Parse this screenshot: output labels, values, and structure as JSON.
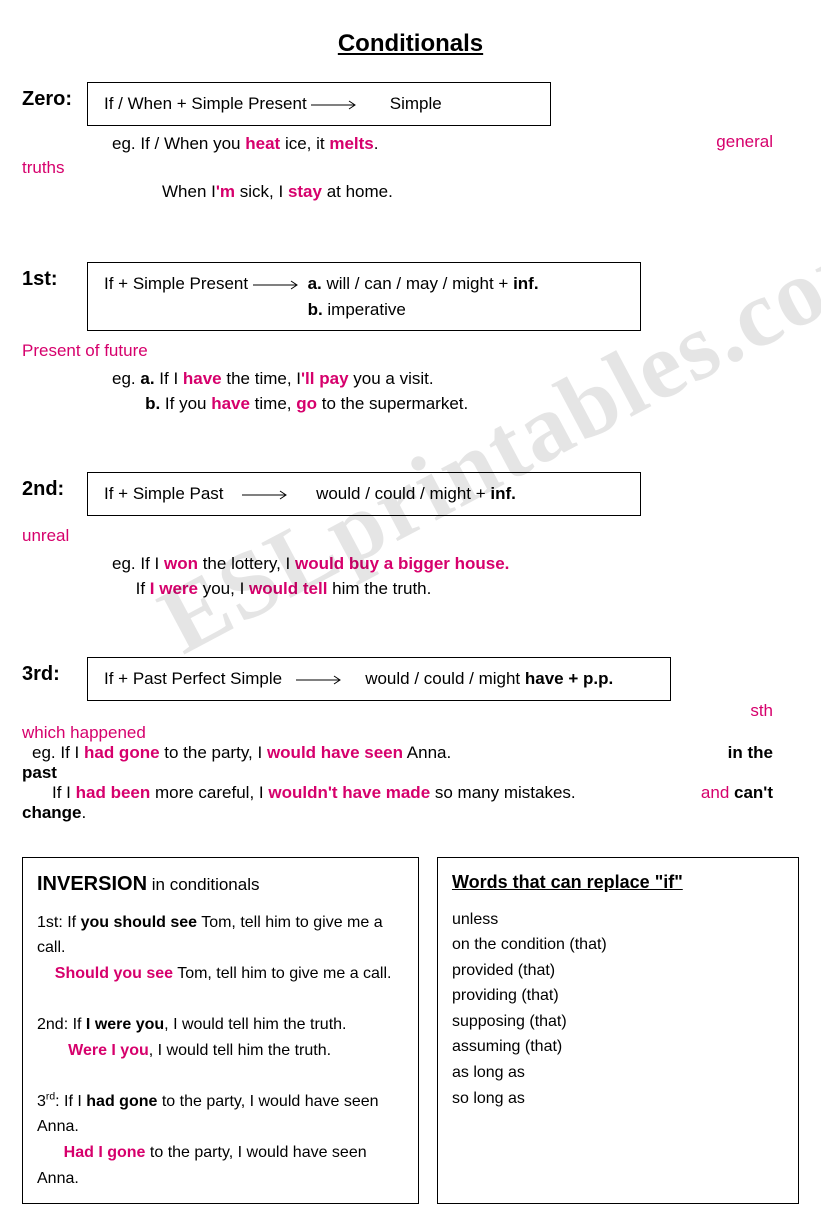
{
  "title": "Conditionals",
  "watermark": "ESLprintables.com",
  "zero": {
    "label": "Zero:",
    "formula_left": "If / When  +  Simple Present",
    "formula_right": "Simple",
    "eg_prefix": "eg.  If / When you ",
    "eg_w1": "heat",
    "eg_mid1": " ice, it ",
    "eg_w2": "melts",
    "eg_end1": ".",
    "tag_right": "general",
    "tag_left": "truths",
    "ex2_a": "When I",
    "ex2_b": "'m",
    "ex2_c": " sick, I ",
    "ex2_d": "stay",
    "ex2_e": " at home."
  },
  "first": {
    "label": "1st:",
    "formula_left": "If  +  Simple Present",
    "formula_ra": "a.",
    "formula_right_a": "  will / can / may / might  + ",
    "formula_right_a2": "inf.",
    "formula_rb": "b.",
    "formula_right_b": "  imperative",
    "tag": "Present of future",
    "eg_line_a_pre": "eg.  ",
    "eg_a_label": "a.",
    "eg_a_1": " If I ",
    "eg_a_2": "have",
    "eg_a_3": " the time, I",
    "eg_a_4": "'ll pay",
    "eg_a_5": " you a visit.",
    "eg_b_label": "b.",
    "eg_b_1": " If you ",
    "eg_b_2": "have",
    "eg_b_3": " time, ",
    "eg_b_4": "go",
    "eg_b_5": " to the supermarket."
  },
  "second": {
    "label": "2nd:",
    "formula_left": "If  +  Simple Past",
    "formula_right": "would / could / might  + ",
    "formula_right2": "inf.",
    "tag": "unreal",
    "eg1_pre": "eg.  If I ",
    "eg1_w1": "won",
    "eg1_mid": " the lottery, I ",
    "eg1_w2": "would buy a bigger house.",
    "eg2_pre": "If ",
    "eg2_w1": "I were",
    "eg2_mid": " you, I ",
    "eg2_w2": "would tell",
    "eg2_end": " him the truth."
  },
  "third": {
    "label": "3rd:",
    "formula_left": "If  +  Past Perfect Simple",
    "formula_right_a": "would / could / might ",
    "formula_right_b": "have + p.p.",
    "tag_r1": "sth",
    "tag_l1": "which happened",
    "eg1_pre": "eg.  If I ",
    "eg1_w1": "had gone",
    "eg1_mid": " to the party, I ",
    "eg1_w2": "would have seen",
    "eg1_end": " Anna.",
    "tag_r2a": "in the",
    "tag_l2": "past",
    "eg2_pre": "If I ",
    "eg2_w1": "had been",
    "eg2_mid": " more careful, I ",
    "eg2_w2": "wouldn't have made",
    "eg2_end": " so many mistakes.",
    "tag_r3a": "and ",
    "tag_r3b": "can't",
    "tag_l3": "change",
    "tag_l3b": "."
  },
  "inversion": {
    "title_a": "INVERSION",
    "title_b": " in conditionals",
    "l1a": "1st:  If ",
    "l1b": "you should see",
    "l1c": " Tom, tell him to give me a call.",
    "l1d": "Should you see",
    "l1e": " Tom, tell him to give me a call.",
    "l2a": "2nd:  If ",
    "l2b": "I were you",
    "l2c": ", I would tell him the truth.",
    "l2d": "Were I you",
    "l2e": ", I would tell him the truth.",
    "l3a_pre": "3",
    "l3a_sup": "rd",
    "l3a": ":  If I ",
    "l3b": "had gone",
    "l3c": " to the party, I would have seen Anna.",
    "l3d": "Had I gone",
    "l3e": " to the party, I would have seen Anna."
  },
  "replace": {
    "title": "Words that can replace \"if\"",
    "items": [
      "unless",
      "on the condition (that)",
      "provided (that)",
      "providing (that)",
      "supposing (that)",
      "assuming (that)",
      "as long as",
      "so long as"
    ]
  }
}
